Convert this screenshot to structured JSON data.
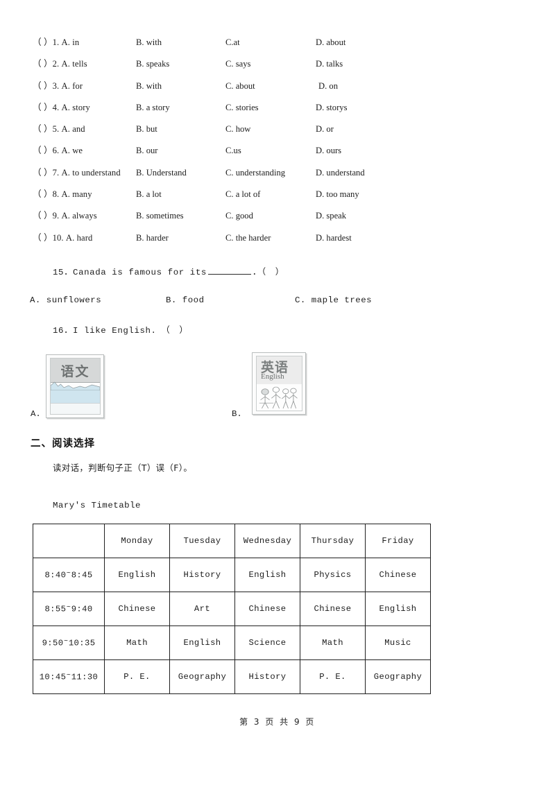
{
  "document": {
    "footer_text": "第 3 页 共 9 页"
  },
  "cloze": {
    "rows": [
      {
        "lead": "（ ）1. A. in",
        "b": "B. with",
        "c": "C.at",
        "d": "D. about"
      },
      {
        "lead": "（ ）2. A. tells",
        "b": "B. speaks",
        "c": "C. says",
        "d": "D. talks"
      },
      {
        "lead": "（ ）3. A. for",
        "b": "B. with",
        "c": "C. about",
        "d": "D. on"
      },
      {
        "lead": "（ ）4. A. story",
        "b": "B. a story",
        "c": "C. stories",
        "d": "D. storys"
      },
      {
        "lead": "（ ）5. A. and",
        "b": "B. but",
        "c": "C. how",
        "d": "D. or"
      },
      {
        "lead": "（ ）6. A. we",
        "b": "B. our",
        "c": "C.us",
        "d": "D. ours"
      },
      {
        "lead": "（ ）7. A. to understand",
        "b": "B. Understand",
        "c": "C. understanding",
        "d": "D. understand"
      },
      {
        "lead": "（ ）8. A. many",
        "b": "B. a lot",
        "c": "C. a lot of",
        "d": "D. too many"
      },
      {
        "lead": "（ ）9. A. always",
        "b": "B. sometimes",
        "c": "C. good",
        "d": "D. speak"
      },
      {
        "lead": "（ ）10. A. hard",
        "b": "B. harder",
        "c": "C. the harder",
        "d": "D. hardest"
      }
    ]
  },
  "question15": {
    "stem_before": "15．Canada is famous for its",
    "stem_after": "．（　）",
    "option_a": "A. sunflowers",
    "option_b": "B. food",
    "option_c": "C. maple trees"
  },
  "question16": {
    "stem": "16．I like English.　（　）",
    "label_a": "A.",
    "label_b": "B.",
    "image_a": {
      "name": "chinese-textbook",
      "title_cn": "语文"
    },
    "image_b": {
      "name": "english-textbook",
      "title_cn": "英语",
      "title_en": "English"
    }
  },
  "section2": {
    "heading": "二、阅读选择",
    "instruction": "读对话，判断句子正（T）误（F）。",
    "timetable_title": "Mary's Timetable"
  },
  "timetable": {
    "headers": [
      "",
      "Monday",
      "Tuesday",
      "Wednesday",
      "Thursday",
      "Friday"
    ],
    "rows": [
      {
        "time_start": "8:40",
        "time_end": "8:45",
        "cells": [
          "English",
          "History",
          "English",
          "Physics",
          "Chinese"
        ]
      },
      {
        "time_start": "8:55",
        "time_end": "9:40",
        "cells": [
          "Chinese",
          "Art",
          "Chinese",
          "Chinese",
          "English"
        ]
      },
      {
        "time_start": "9:50",
        "time_end": "10:35",
        "cells": [
          "Math",
          "English",
          "Science",
          "Math",
          "Music"
        ]
      },
      {
        "time_start": "10:45",
        "time_end": "11:30",
        "cells": [
          "P. E.",
          "Geography",
          "History",
          "P. E.",
          "Geography"
        ]
      }
    ]
  },
  "colors": {
    "page_background": "#ffffff",
    "text": "#1c1c1c",
    "table_border": "#1f1f1f",
    "book_water": "#cfe5ef",
    "book_titlebar": "#d6d8d8"
  }
}
